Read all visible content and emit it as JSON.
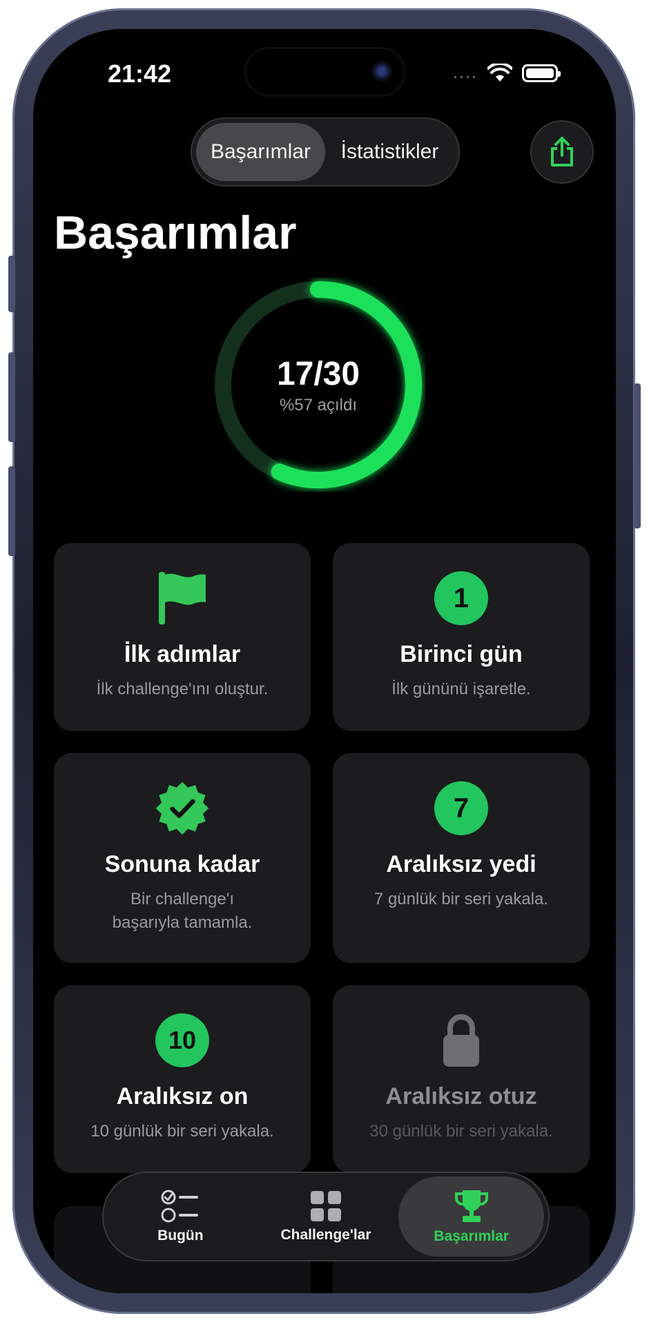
{
  "status_bar": {
    "time": "21:42",
    "dots": "....",
    "icons": [
      "wifi-icon",
      "battery-icon"
    ]
  },
  "segmented_control": {
    "tabs": [
      {
        "label": "Başarımlar",
        "active": true
      },
      {
        "label": "İstatistikler",
        "active": false
      }
    ]
  },
  "share_button": {
    "icon": "share-icon"
  },
  "page_title": "Başarımlar",
  "progress": {
    "count_label": "17/30",
    "unlocked": 17,
    "total": 30,
    "percent_label": "%57 açıldı"
  },
  "achievements": [
    {
      "icon": "flag-icon",
      "title": "İlk adımlar",
      "desc": "İlk challenge'ını oluştur.",
      "locked": false
    },
    {
      "icon": "number-badge-icon",
      "badge": "1",
      "title": "Birinci gün",
      "desc": "İlk gününü işaretle.",
      "locked": false
    },
    {
      "icon": "checkmark-seal-icon",
      "title": "Sonuna kadar",
      "desc": "Bir challenge'ı başarıyla tamamla.",
      "locked": false
    },
    {
      "icon": "number-badge-icon",
      "badge": "7",
      "title": "Aralıksız yedi",
      "desc": "7 günlük bir seri yakala.",
      "locked": false
    },
    {
      "icon": "number-badge-icon",
      "badge": "10",
      "title": "Aralıksız on",
      "desc": "10 günlük bir seri yakala.",
      "locked": false
    },
    {
      "icon": "lock-icon",
      "title": "Aralıksız otuz",
      "desc": "30 günlük bir seri yakala.",
      "locked": true
    }
  ],
  "tab_bar": {
    "tabs": [
      {
        "label": "Bugün",
        "icon": "checklist-icon",
        "active": false
      },
      {
        "label": "Challenge'lar",
        "icon": "grid-icon",
        "active": false
      },
      {
        "label": "Başarımlar",
        "icon": "trophy-icon",
        "active": true
      }
    ]
  },
  "colors": {
    "accent": "#30d158",
    "background": "#000000",
    "card": "#1c1c1e"
  }
}
